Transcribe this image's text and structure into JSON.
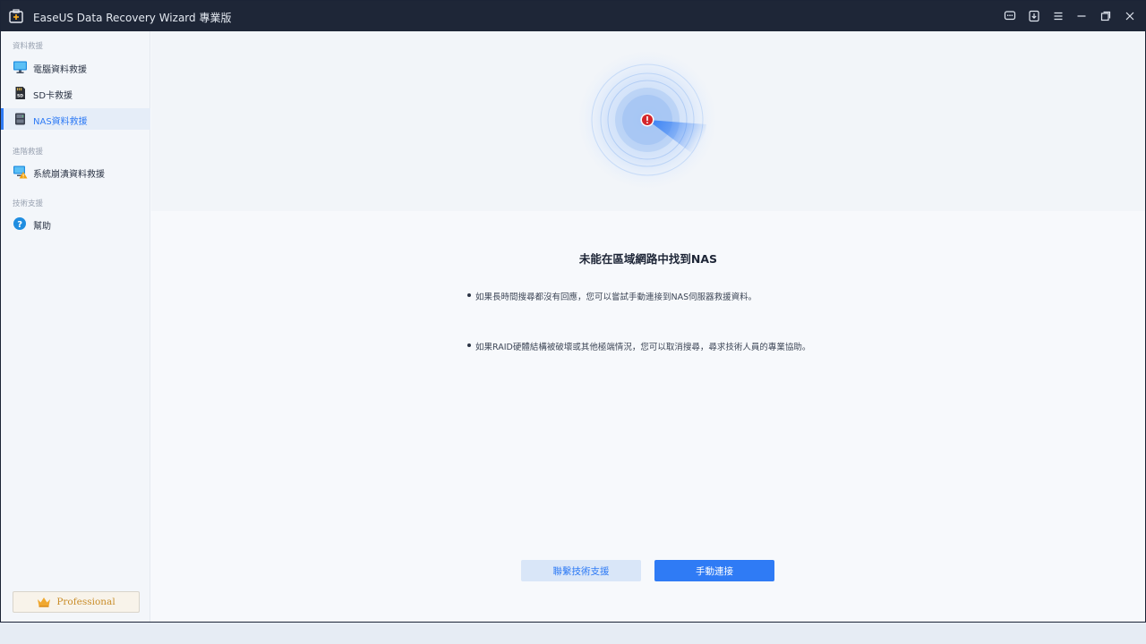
{
  "window": {
    "title": "EaseUS Data Recovery Wizard 專業版",
    "accent_color": "#2f7bf5",
    "titlebar_color": "#1e2637"
  },
  "titlebar": {
    "buttons": [
      "feedback-icon",
      "download-icon",
      "menu-icon",
      "minimize-icon",
      "restore-icon",
      "close-icon"
    ]
  },
  "sidebar": {
    "sections": [
      {
        "label": "資料救援",
        "items": [
          {
            "label": "電腦資料救援",
            "icon": "monitor-icon",
            "active": false
          },
          {
            "label": "SD卡救援",
            "icon": "sd-card-icon",
            "active": false
          },
          {
            "label": "NAS資料救援",
            "icon": "nas-icon",
            "active": true
          }
        ]
      },
      {
        "label": "進階救援",
        "items": [
          {
            "label": "系統崩潰資料救援",
            "icon": "system-crash-icon",
            "active": false
          }
        ]
      },
      {
        "label": "技術支援",
        "items": [
          {
            "label": "幫助",
            "icon": "help-icon",
            "active": false
          }
        ]
      }
    ],
    "professional_label": "Professional"
  },
  "main": {
    "heading": "未能在區域網路中找到NAS",
    "tips": [
      "如果長時間搜尋都沒有回應，您可以嘗試手動連接到NAS伺服器救援資料。",
      "如果RAID硬體結構被破壞或其他極端情況，您可以取消搜尋，尋求技術人員的專業協助。"
    ],
    "contact_button": "聯繫技術支援",
    "manual_button": "手動連接"
  }
}
